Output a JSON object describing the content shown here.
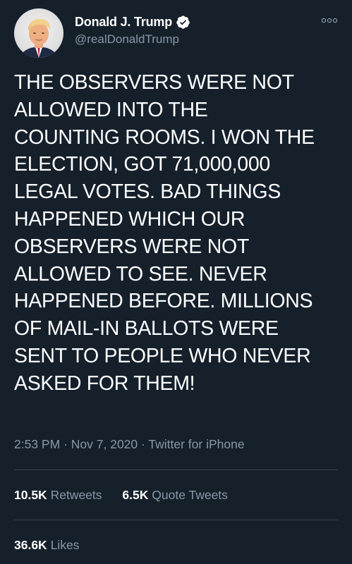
{
  "author": {
    "display_name": "Donald J. Trump",
    "handle": "@realDonaldTrump",
    "verified": true
  },
  "tweet": {
    "lines": [
      "THE OBSERVERS WERE NOT",
      "ALLOWED INTO THE",
      "COUNTING ROOMS. I WON THE",
      "ELECTION, GOT 71,000,000",
      "LEGAL VOTES. BAD THINGS",
      "HAPPENED WHICH OUR",
      "OBSERVERS WERE NOT",
      "ALLOWED TO SEE. NEVER",
      "HAPPENED BEFORE. MILLIONS",
      "OF MAIL-IN BALLOTS WERE",
      "SENT TO PEOPLE WHO NEVER",
      "ASKED FOR THEM!"
    ],
    "time": "2:53 PM",
    "date": "Nov 7, 2020",
    "source": "Twitter for iPhone",
    "separator": "·"
  },
  "stats": {
    "retweets_count": "10.5K",
    "retweets_label": "Retweets",
    "quote_tweets_count": "6.5K",
    "quote_tweets_label": "Quote Tweets",
    "likes_count": "36.6K",
    "likes_label": "Likes"
  },
  "colors": {
    "background": "#15202b",
    "text_primary": "#ffffff",
    "text_secondary": "#8899a6",
    "divider": "#38444d",
    "verified_badge": "#ffffff"
  },
  "icons": {
    "avatar": "avatar",
    "verified": "verified-badge-icon",
    "more": "more-options-icon"
  }
}
